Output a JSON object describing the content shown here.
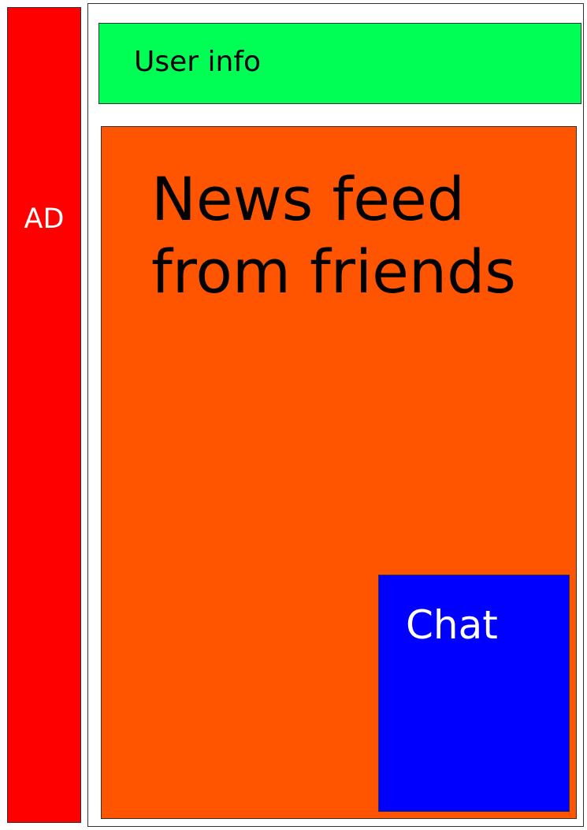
{
  "ad": {
    "label": "AD",
    "color": "#ff0000"
  },
  "user_info": {
    "label": "User info",
    "color": "#00ff55"
  },
  "news_feed": {
    "label": "News feed from friends",
    "color": "#ff5500"
  },
  "chat": {
    "label": "Chat",
    "color": "#0000ff"
  }
}
